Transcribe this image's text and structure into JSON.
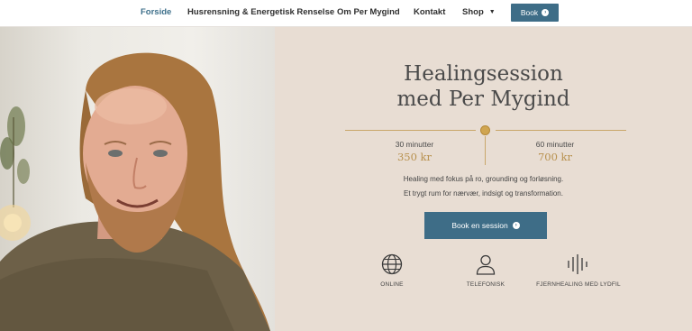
{
  "nav": {
    "items": [
      {
        "label": "Forside",
        "active": true
      },
      {
        "label": "Husrensning & Energetisk Renselse",
        "active": false
      },
      {
        "label": "Om Per Mygind",
        "active": false
      },
      {
        "label": "Kontakt",
        "active": false
      },
      {
        "label": "Shop",
        "active": false
      }
    ],
    "book_label": "Book"
  },
  "hero": {
    "title_line1": "Healingsession",
    "title_line2": "med Per Mygind",
    "prices": [
      {
        "duration": "30 minutter",
        "price": "350 kr"
      },
      {
        "duration": "60 minutter",
        "price": "700 kr"
      }
    ],
    "desc_line1": "Healing med fokus på ro, grounding og forløsning.",
    "desc_line2": "Et trygt rum for nærvær, indsigt og transformation.",
    "cta_label": "Book en session"
  },
  "features": [
    {
      "label": "ONLINE",
      "icon": "globe-icon"
    },
    {
      "label": "TELEFONISK",
      "icon": "person-icon"
    },
    {
      "label": "FJERNHEALING MED LYDFIL",
      "icon": "soundwave-icon"
    }
  ],
  "colors": {
    "accent": "#3e6d87",
    "gold": "#c9a76a",
    "background": "#e8ddd3",
    "nav_active": "#3d6f8a"
  }
}
